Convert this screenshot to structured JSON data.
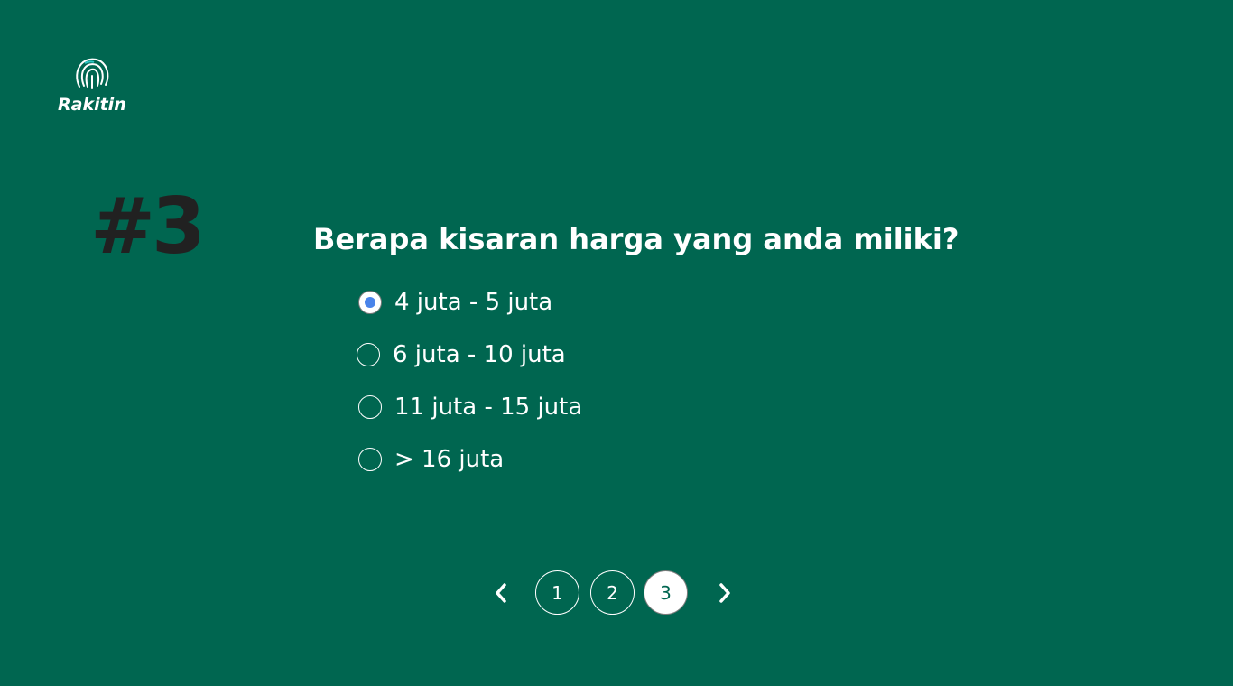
{
  "brand": {
    "name": "Rakitin",
    "icon": "fingerprint-icon"
  },
  "question": {
    "number": "#3",
    "text": "Berapa kisaran harga yang anda miliki?",
    "selected_index": 0,
    "options": [
      {
        "label": "4 juta - 5 juta",
        "checked": true
      },
      {
        "label": "6 juta - 10 juta",
        "checked": false
      },
      {
        "label": "11 juta - 15 juta",
        "checked": false
      },
      {
        "label": "> 16 juta",
        "checked": false
      }
    ]
  },
  "pagination": {
    "prev_icon": "chevron-left-icon",
    "next_icon": "chevron-right-icon",
    "pages": [
      "1",
      "2",
      "3"
    ],
    "current": "3"
  },
  "colors": {
    "background": "#006650",
    "question_number": "#212121",
    "radio_selected": "#4a84ea",
    "text": "#ffffff"
  }
}
